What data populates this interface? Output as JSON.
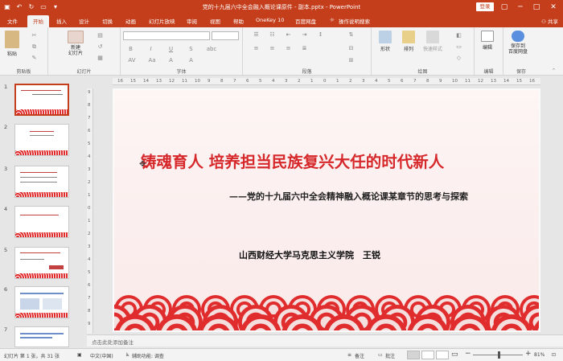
{
  "window": {
    "title": "党的十九届六中全会融入概论课原件 - 副本.pptx - PowerPoint",
    "login_label": "登录"
  },
  "tabs": [
    "文件",
    "开始",
    "插入",
    "设计",
    "切换",
    "动画",
    "幻灯片放映",
    "审阅",
    "视图",
    "帮助",
    "OneKey 10",
    "百度网盘",
    "操作说明搜索"
  ],
  "share_label": "共享",
  "ribbon": {
    "groups": {
      "clipboard": "剪贴板",
      "slides": "幻灯片",
      "font": "字体",
      "paragraph": "段落",
      "drawing": "绘图",
      "edit": "编辑",
      "save": "保存"
    },
    "buttons": {
      "paste": "粘贴",
      "new_slide": "新建\n幻灯片",
      "shapes": "形状",
      "arrange": "排列",
      "quick_styles": "快速样式",
      "edit": "编辑",
      "save_to_baidu": "保存到\n百度网盘"
    },
    "font_tools": [
      "B",
      "I",
      "U",
      "S",
      "abc",
      "AV",
      "Aa",
      "A",
      "A"
    ]
  },
  "thumbnails": [
    "1",
    "2",
    "3",
    "4",
    "5",
    "6",
    "7"
  ],
  "ruler": {
    "h_ticks": [
      "16",
      "15",
      "14",
      "13",
      "12",
      "11",
      "10",
      "9",
      "8",
      "7",
      "6",
      "5",
      "4",
      "3",
      "2",
      "1",
      "0",
      "1",
      "2",
      "3",
      "4",
      "5",
      "6",
      "7",
      "8",
      "9",
      "10",
      "11",
      "12",
      "13",
      "14",
      "15",
      "16"
    ],
    "v_ticks": [
      "9",
      "8",
      "7",
      "6",
      "5",
      "4",
      "3",
      "2",
      "1",
      "0",
      "1",
      "2",
      "3",
      "4",
      "5",
      "6",
      "7",
      "8",
      "9"
    ]
  },
  "slide": {
    "title": "铸魂育人 培养担当民族复兴大任的时代新人",
    "subtitle": "——党的十九届六中全会精神融入概论课某章节的思考与探索",
    "author": "山西财经大学马克思主义学院　王锐"
  },
  "notes_placeholder": "点击此处添加备注",
  "status": {
    "slide_info": "幻灯片 第 1 张，共 31 张",
    "language": "中文(中国)",
    "accessibility": "辅助功能: 调查",
    "notes": "备注",
    "comments": "批注",
    "zoom": "81%"
  },
  "colors": {
    "accent": "#c43e1c",
    "title_red": "#d6282b",
    "wave_red": "#e02c2c"
  }
}
